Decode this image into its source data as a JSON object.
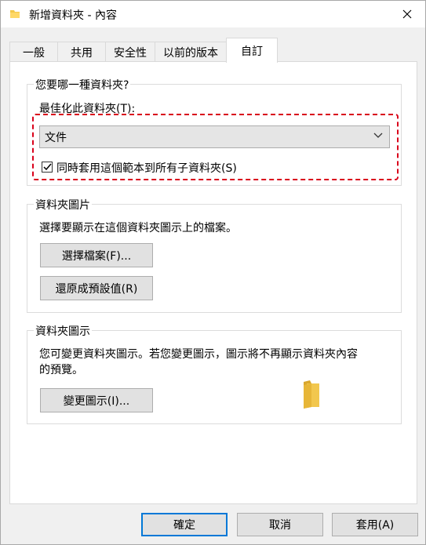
{
  "window": {
    "title": "新增資料夾 - 內容",
    "icon": "folder-icon"
  },
  "tabs": [
    {
      "label": "一般"
    },
    {
      "label": "共用"
    },
    {
      "label": "安全性"
    },
    {
      "label": "以前的版本"
    },
    {
      "label": "自訂",
      "active": true
    }
  ],
  "group_folder_type": {
    "title": "您要哪一種資料夾?",
    "optimize_label": "最佳化此資料夾(T):",
    "optimize_value": "文件",
    "apply_subfolders_label": "同時套用這個範本到所有子資料夾(S)",
    "apply_subfolders_checked": true
  },
  "group_folder_picture": {
    "title": "資料夾圖片",
    "description": "選擇要顯示在這個資料夾圖示上的檔案。",
    "choose_file_button": "選擇檔案(F)...",
    "restore_default_button": "還原成預設值(R)"
  },
  "group_folder_icon": {
    "title": "資料夾圖示",
    "description_line1": "您可變更資料夾圖示。若您變更圖示，圖示將不再顯示資料夾內容",
    "description_line2": "的預覽。",
    "change_icon_button": "變更圖示(I)..."
  },
  "footer": {
    "ok_button": "確定",
    "cancel_button": "取消",
    "apply_button": "套用(A)"
  },
  "colors": {
    "highlight": "#d9001b",
    "default_button_border": "#0078d7",
    "folder": "#e8c04a"
  }
}
